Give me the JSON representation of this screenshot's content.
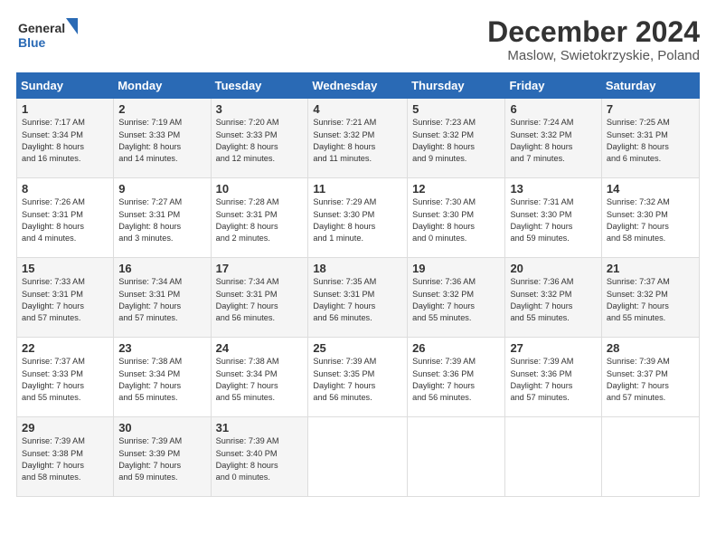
{
  "header": {
    "logo_line1": "General",
    "logo_line2": "Blue",
    "title": "December 2024",
    "location": "Maslow, Swietokrzyskie, Poland"
  },
  "weekdays": [
    "Sunday",
    "Monday",
    "Tuesday",
    "Wednesday",
    "Thursday",
    "Friday",
    "Saturday"
  ],
  "weeks": [
    [
      {
        "day": "1",
        "lines": [
          "Sunrise: 7:17 AM",
          "Sunset: 3:34 PM",
          "Daylight: 8 hours",
          "and 16 minutes."
        ]
      },
      {
        "day": "2",
        "lines": [
          "Sunrise: 7:19 AM",
          "Sunset: 3:33 PM",
          "Daylight: 8 hours",
          "and 14 minutes."
        ]
      },
      {
        "day": "3",
        "lines": [
          "Sunrise: 7:20 AM",
          "Sunset: 3:33 PM",
          "Daylight: 8 hours",
          "and 12 minutes."
        ]
      },
      {
        "day": "4",
        "lines": [
          "Sunrise: 7:21 AM",
          "Sunset: 3:32 PM",
          "Daylight: 8 hours",
          "and 11 minutes."
        ]
      },
      {
        "day": "5",
        "lines": [
          "Sunrise: 7:23 AM",
          "Sunset: 3:32 PM",
          "Daylight: 8 hours",
          "and 9 minutes."
        ]
      },
      {
        "day": "6",
        "lines": [
          "Sunrise: 7:24 AM",
          "Sunset: 3:32 PM",
          "Daylight: 8 hours",
          "and 7 minutes."
        ]
      },
      {
        "day": "7",
        "lines": [
          "Sunrise: 7:25 AM",
          "Sunset: 3:31 PM",
          "Daylight: 8 hours",
          "and 6 minutes."
        ]
      }
    ],
    [
      {
        "day": "8",
        "lines": [
          "Sunrise: 7:26 AM",
          "Sunset: 3:31 PM",
          "Daylight: 8 hours",
          "and 4 minutes."
        ]
      },
      {
        "day": "9",
        "lines": [
          "Sunrise: 7:27 AM",
          "Sunset: 3:31 PM",
          "Daylight: 8 hours",
          "and 3 minutes."
        ]
      },
      {
        "day": "10",
        "lines": [
          "Sunrise: 7:28 AM",
          "Sunset: 3:31 PM",
          "Daylight: 8 hours",
          "and 2 minutes."
        ]
      },
      {
        "day": "11",
        "lines": [
          "Sunrise: 7:29 AM",
          "Sunset: 3:30 PM",
          "Daylight: 8 hours",
          "and 1 minute."
        ]
      },
      {
        "day": "12",
        "lines": [
          "Sunrise: 7:30 AM",
          "Sunset: 3:30 PM",
          "Daylight: 8 hours",
          "and 0 minutes."
        ]
      },
      {
        "day": "13",
        "lines": [
          "Sunrise: 7:31 AM",
          "Sunset: 3:30 PM",
          "Daylight: 7 hours",
          "and 59 minutes."
        ]
      },
      {
        "day": "14",
        "lines": [
          "Sunrise: 7:32 AM",
          "Sunset: 3:30 PM",
          "Daylight: 7 hours",
          "and 58 minutes."
        ]
      }
    ],
    [
      {
        "day": "15",
        "lines": [
          "Sunrise: 7:33 AM",
          "Sunset: 3:31 PM",
          "Daylight: 7 hours",
          "and 57 minutes."
        ]
      },
      {
        "day": "16",
        "lines": [
          "Sunrise: 7:34 AM",
          "Sunset: 3:31 PM",
          "Daylight: 7 hours",
          "and 57 minutes."
        ]
      },
      {
        "day": "17",
        "lines": [
          "Sunrise: 7:34 AM",
          "Sunset: 3:31 PM",
          "Daylight: 7 hours",
          "and 56 minutes."
        ]
      },
      {
        "day": "18",
        "lines": [
          "Sunrise: 7:35 AM",
          "Sunset: 3:31 PM",
          "Daylight: 7 hours",
          "and 56 minutes."
        ]
      },
      {
        "day": "19",
        "lines": [
          "Sunrise: 7:36 AM",
          "Sunset: 3:32 PM",
          "Daylight: 7 hours",
          "and 55 minutes."
        ]
      },
      {
        "day": "20",
        "lines": [
          "Sunrise: 7:36 AM",
          "Sunset: 3:32 PM",
          "Daylight: 7 hours",
          "and 55 minutes."
        ]
      },
      {
        "day": "21",
        "lines": [
          "Sunrise: 7:37 AM",
          "Sunset: 3:32 PM",
          "Daylight: 7 hours",
          "and 55 minutes."
        ]
      }
    ],
    [
      {
        "day": "22",
        "lines": [
          "Sunrise: 7:37 AM",
          "Sunset: 3:33 PM",
          "Daylight: 7 hours",
          "and 55 minutes."
        ]
      },
      {
        "day": "23",
        "lines": [
          "Sunrise: 7:38 AM",
          "Sunset: 3:34 PM",
          "Daylight: 7 hours",
          "and 55 minutes."
        ]
      },
      {
        "day": "24",
        "lines": [
          "Sunrise: 7:38 AM",
          "Sunset: 3:34 PM",
          "Daylight: 7 hours",
          "and 55 minutes."
        ]
      },
      {
        "day": "25",
        "lines": [
          "Sunrise: 7:39 AM",
          "Sunset: 3:35 PM",
          "Daylight: 7 hours",
          "and 56 minutes."
        ]
      },
      {
        "day": "26",
        "lines": [
          "Sunrise: 7:39 AM",
          "Sunset: 3:36 PM",
          "Daylight: 7 hours",
          "and 56 minutes."
        ]
      },
      {
        "day": "27",
        "lines": [
          "Sunrise: 7:39 AM",
          "Sunset: 3:36 PM",
          "Daylight: 7 hours",
          "and 57 minutes."
        ]
      },
      {
        "day": "28",
        "lines": [
          "Sunrise: 7:39 AM",
          "Sunset: 3:37 PM",
          "Daylight: 7 hours",
          "and 57 minutes."
        ]
      }
    ],
    [
      {
        "day": "29",
        "lines": [
          "Sunrise: 7:39 AM",
          "Sunset: 3:38 PM",
          "Daylight: 7 hours",
          "and 58 minutes."
        ]
      },
      {
        "day": "30",
        "lines": [
          "Sunrise: 7:39 AM",
          "Sunset: 3:39 PM",
          "Daylight: 7 hours",
          "and 59 minutes."
        ]
      },
      {
        "day": "31",
        "lines": [
          "Sunrise: 7:39 AM",
          "Sunset: 3:40 PM",
          "Daylight: 8 hours",
          "and 0 minutes."
        ]
      },
      null,
      null,
      null,
      null
    ]
  ]
}
